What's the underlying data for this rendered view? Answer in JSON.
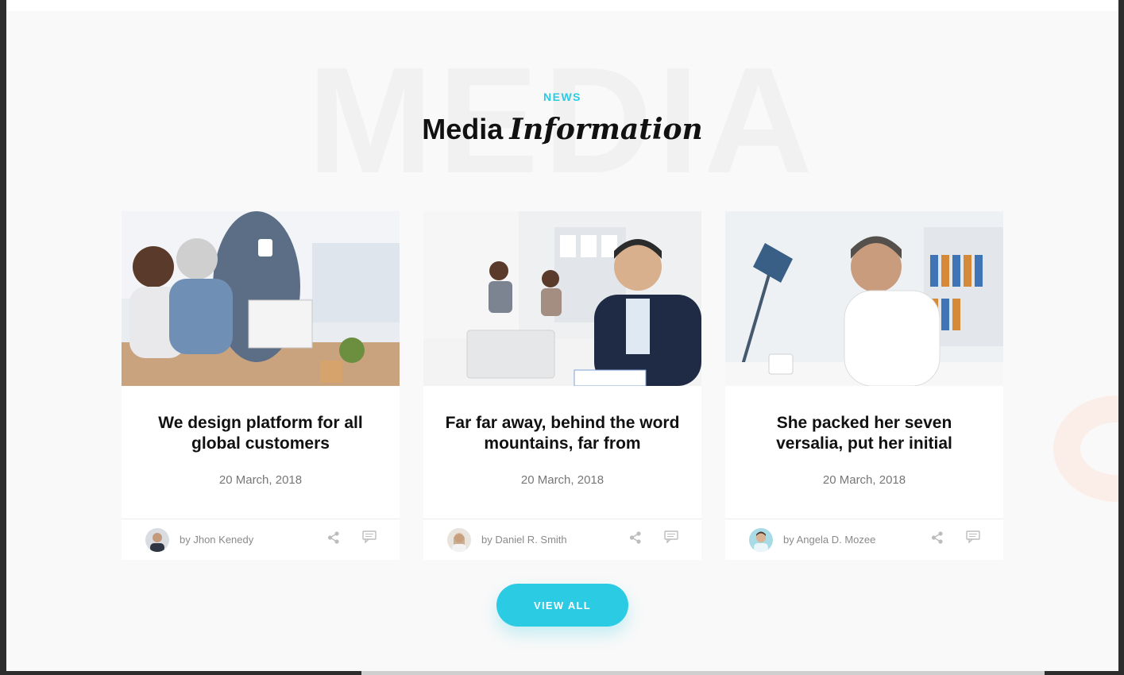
{
  "section": {
    "watermark": "MEDIA",
    "eyebrow": "NEWS",
    "title_plain": "Media",
    "title_italic": "Information"
  },
  "posts": [
    {
      "title": "We design platform for all global customers",
      "date": "20 March, 2018",
      "author": "by Jhon Kenedy"
    },
    {
      "title": "Far far away, behind the word mountains, far from",
      "date": "20 March, 2018",
      "author": "by Daniel R. Smith"
    },
    {
      "title": "She packed her seven versalia, put her initial",
      "date": "20 March, 2018",
      "author": "by Angela D. Mozee"
    }
  ],
  "cta": {
    "label": "VIEW ALL"
  },
  "colors": {
    "accent": "#2bcbe4",
    "background": "#f9f9f9",
    "card": "#ffffff"
  },
  "icons": [
    "share-icon",
    "comment-icon"
  ]
}
